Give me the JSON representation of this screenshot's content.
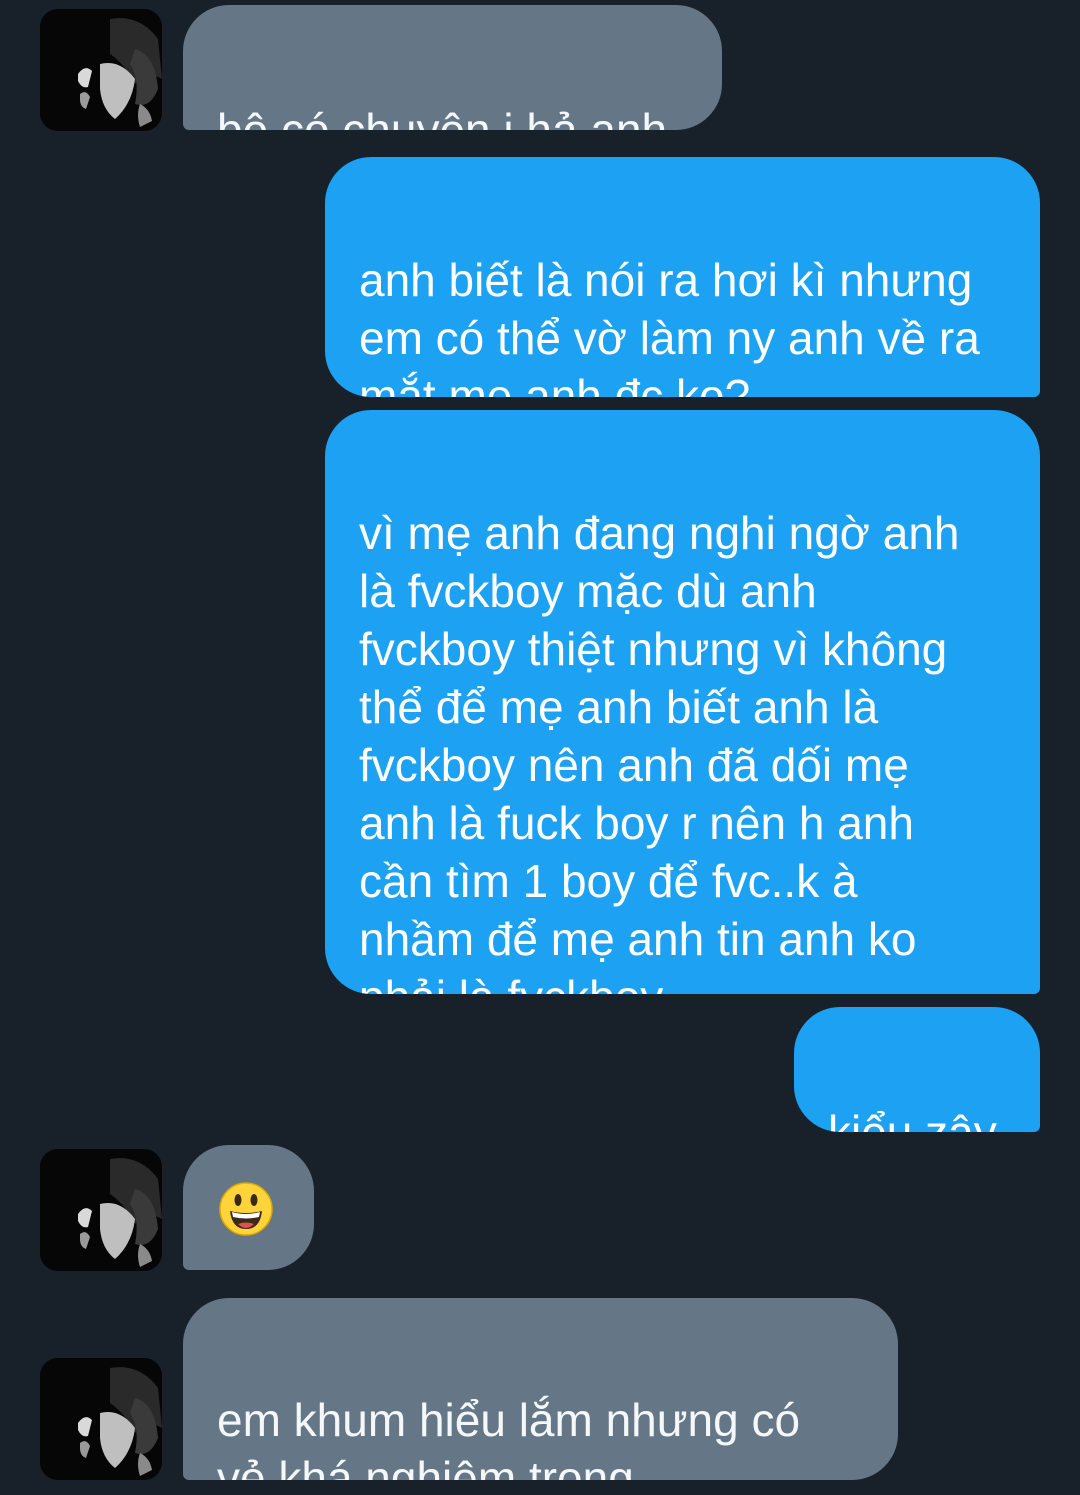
{
  "conversation": {
    "messages": [
      {
        "side": "received",
        "text": "bộ có chuyện j hả anh"
      },
      {
        "side": "sent",
        "text": "anh biết là nói ra hơi kì nhưng\nem có thể vờ làm ny anh về ra\nmắt mẹ anh đc ko?"
      },
      {
        "side": "sent",
        "text": "vì mẹ anh đang nghi ngờ anh\nlà fvckboy mặc dù anh\nfvckboy thiệt nhưng vì không\nthể để mẹ anh biết anh là\nfvckboy nên anh đã dối mẹ\nanh là fuck boy r nên h anh\ncần tìm 1 boy để fvc..k à\nnhầm để mẹ anh tin anh ko\nphải là fvckboy"
      },
      {
        "side": "sent",
        "text": "kiểu zậy"
      },
      {
        "side": "received",
        "emoji": "grinning-face-emoji"
      },
      {
        "side": "received",
        "text": "em khum hiểu lắm nhưng có\nvẻ khá nghiêm trọng"
      }
    ]
  },
  "colors": {
    "background": "#18202a",
    "received_bubble": "#657786",
    "sent_bubble": "#1da1f2",
    "text": "#ffffff"
  }
}
